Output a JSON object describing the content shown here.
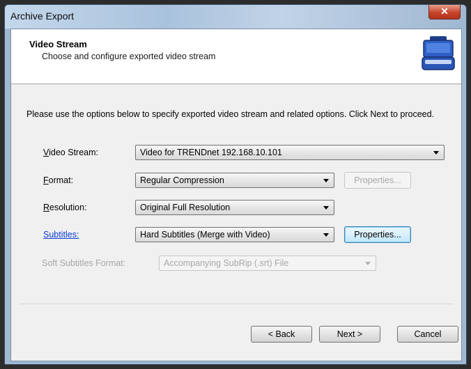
{
  "window": {
    "title": "Archive Export",
    "close_glyph": "✕"
  },
  "header": {
    "title": "Video Stream",
    "subtitle": "Choose and configure exported video stream",
    "icon": "archive-case-icon"
  },
  "intro": "Please use the options below to specify exported video stream and related options. Click Next to proceed.",
  "fields": {
    "video_stream": {
      "label_u": "V",
      "label_rest": "ideo Stream:",
      "value": "Video for TRENDnet 192.168.10.101"
    },
    "format": {
      "label_u": "F",
      "label_rest": "ormat:",
      "value": "Regular Compression",
      "properties": "Properties..."
    },
    "resolution": {
      "label_u": "R",
      "label_rest": "esolution:",
      "value": "Original Full Resolution"
    },
    "subtitles": {
      "label": "Subtitles:",
      "value": "Hard Subtitles (Merge with Video)",
      "properties": "Properties..."
    },
    "soft_subtitles_format": {
      "label": "Soft Subtitles Format:",
      "value": "Accompanying SubRip (.srt) File"
    }
  },
  "buttons": {
    "back": "< Back",
    "next": "Next >",
    "cancel": "Cancel"
  }
}
